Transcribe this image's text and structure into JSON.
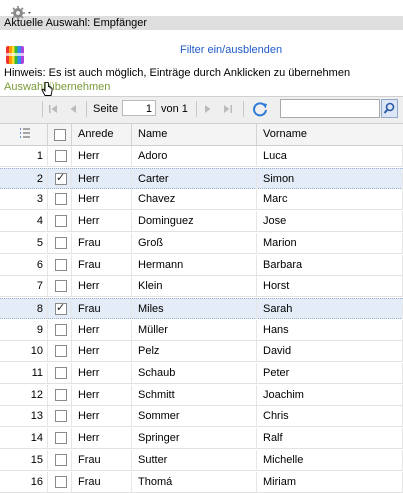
{
  "window": {
    "title": "Aktuelle Auswahl: Empfänger"
  },
  "toolbar": {
    "filter_toggle": "Filter ein/ausblenden",
    "hint": "Hinweis: Es ist auch möglich, Einträge durch Anklicken zu übernehmen",
    "apply_selection": "Auswahl übernehmen"
  },
  "pager": {
    "page_label": "Seite",
    "page_value": "1",
    "of_label": "von 1",
    "search_placeholder": ""
  },
  "grid": {
    "columns": [
      "Anrede",
      "Name",
      "Vorname"
    ],
    "rows": [
      {
        "no": "1",
        "checked": false,
        "anrede": "Herr",
        "name": "Adoro",
        "vorname": "Luca"
      },
      {
        "no": "2",
        "checked": true,
        "anrede": "Herr",
        "name": "Carter",
        "vorname": "Simon"
      },
      {
        "no": "3",
        "checked": false,
        "anrede": "Herr",
        "name": "Chavez",
        "vorname": "Marc"
      },
      {
        "no": "4",
        "checked": false,
        "anrede": "Herr",
        "name": "Dominguez",
        "vorname": "Jose"
      },
      {
        "no": "5",
        "checked": false,
        "anrede": "Frau",
        "name": "Groß",
        "vorname": "Marion"
      },
      {
        "no": "6",
        "checked": false,
        "anrede": "Frau",
        "name": "Hermann",
        "vorname": "Barbara"
      },
      {
        "no": "7",
        "checked": false,
        "anrede": "Herr",
        "name": "Klein",
        "vorname": "Horst"
      },
      {
        "no": "8",
        "checked": true,
        "anrede": "Frau",
        "name": "Miles",
        "vorname": "Sarah"
      },
      {
        "no": "9",
        "checked": false,
        "anrede": "Herr",
        "name": "Müller",
        "vorname": "Hans"
      },
      {
        "no": "10",
        "checked": false,
        "anrede": "Herr",
        "name": "Pelz",
        "vorname": "David"
      },
      {
        "no": "11",
        "checked": false,
        "anrede": "Herr",
        "name": "Schaub",
        "vorname": "Peter"
      },
      {
        "no": "12",
        "checked": false,
        "anrede": "Herr",
        "name": "Schmitt",
        "vorname": "Joachim"
      },
      {
        "no": "13",
        "checked": false,
        "anrede": "Herr",
        "name": "Sommer",
        "vorname": "Chris"
      },
      {
        "no": "14",
        "checked": false,
        "anrede": "Herr",
        "name": "Springer",
        "vorname": "Ralf"
      },
      {
        "no": "15",
        "checked": false,
        "anrede": "Frau",
        "name": "Sutter",
        "vorname": "Michelle"
      },
      {
        "no": "16",
        "checked": false,
        "anrede": "Frau",
        "name": "Thomá",
        "vorname": "Miriam"
      }
    ]
  },
  "colors": {
    "link": "#1f5bc8",
    "apply_link": "#7a9a3a",
    "selected_row": "#e4ecf7"
  }
}
